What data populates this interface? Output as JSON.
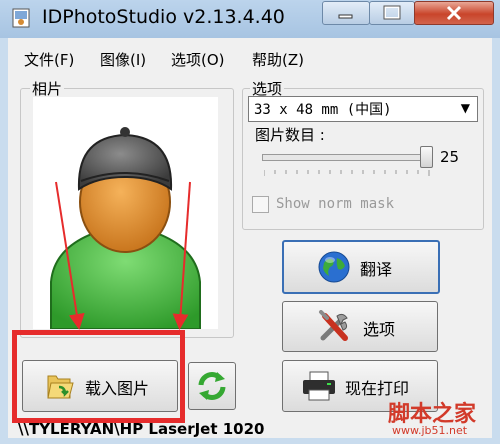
{
  "window": {
    "title": "IDPhotoStudio v2.13.4.40",
    "close_color": "#c9452b"
  },
  "menu": {
    "items": [
      "文件(F)",
      "图像(I)",
      "选项(O)",
      "帮助(Z)"
    ]
  },
  "photo_group": {
    "label": "相片"
  },
  "options_group": {
    "label": "选项",
    "size_select": "33 x 48 mm (中国)",
    "count_label": "图片数目 :",
    "count_value": "25",
    "show_norm_mask_label": "Show norm mask",
    "show_norm_mask_checked": false
  },
  "buttons": {
    "translate": "翻译",
    "options": "选项",
    "print_now": "现在打印",
    "load_photo": "载入图片"
  },
  "status": {
    "printer": "\\\\TYLERYAN\\HP LaserJet 1020"
  },
  "watermark": {
    "text": "脚本之家",
    "url": "www.jb51.net"
  },
  "annotation_color": "#e62c2c"
}
